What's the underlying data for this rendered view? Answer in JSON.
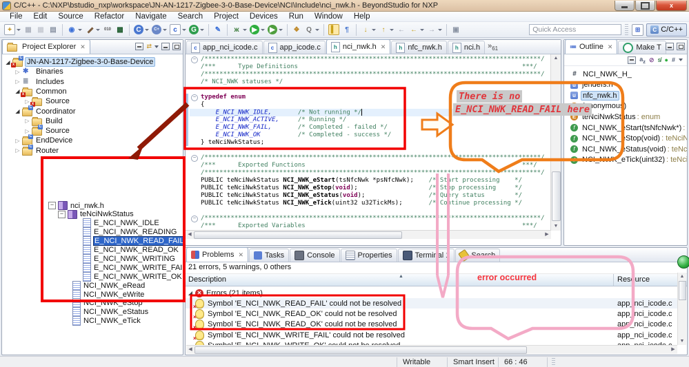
{
  "titlebar": {
    "title": "C/C++ - C:\\NXP\\bstudio_nxp\\workspace\\JN-AN-1217-Zigbee-3-0-Base-Device\\NCI\\Include\\nci_nwk.h - BeyondStudio for NXP"
  },
  "menubar": {
    "items": [
      "File",
      "Edit",
      "Source",
      "Refactor",
      "Navigate",
      "Search",
      "Project",
      "Devices",
      "Run",
      "Window",
      "Help"
    ]
  },
  "toolbar": {
    "quick_access_placeholder": "Quick Access",
    "perspective_label": "C/C++",
    "groups": [
      [
        {
          "n": "new-button",
          "g": "+",
          "cls": "box",
          "c": "#b8860b",
          "dd": 1
        },
        {
          "n": "save-button",
          "g": "▦",
          "c": "#b0b5c0"
        },
        {
          "n": "save-all-button",
          "g": "▦",
          "c": "#c8ccd4"
        },
        {
          "n": "print-button",
          "g": "▤",
          "c": "#8a93a3"
        }
      ],
      [
        {
          "n": "skip-breakpoints-button",
          "g": "◉",
          "c": "#3a6fd8",
          "dd": 1
        },
        {
          "n": "build-button",
          "g": "▬",
          "cls": "rot",
          "c": "#7a5c3e",
          "dd": 1
        },
        {
          "n": "binary-button",
          "g": "010",
          "cls": "tiny",
          "c": "#555"
        },
        {
          "n": "build-all-button",
          "g": "▩",
          "c": "#1e5c2e"
        }
      ],
      [
        {
          "n": "new-c-project-button",
          "g": "C",
          "cls": "round",
          "c": "#fff",
          "bg": "#4a78d0",
          "dd": 1
        },
        {
          "n": "new-cpp-project-button",
          "g": "C+",
          "cls": "tiny round",
          "c": "#fff",
          "bg": "#6a88c8",
          "dd": 1
        },
        {
          "n": "new-c-file-button",
          "g": "c",
          "cls": "box",
          "c": "#2f5fd0",
          "dd": 1
        },
        {
          "n": "relaunch-button",
          "g": "G",
          "cls": "round",
          "c": "#fff",
          "bg": "#2f9e4f",
          "dd": 1
        }
      ],
      [
        {
          "n": "pen-button",
          "g": "✎",
          "c": "#3a6fd8"
        }
      ],
      [
        {
          "n": "debug-button",
          "g": "ж",
          "c": "#3e7d3e",
          "dd": 1
        },
        {
          "n": "run-button",
          "g": "▶",
          "cls": "round",
          "c": "#fff",
          "bg": "#2fae3f",
          "dd": 1
        },
        {
          "n": "external-tools-button",
          "g": "▶",
          "cls": "round",
          "c": "#fff",
          "bg": "#4f9e3f",
          "dd": 1
        }
      ],
      [
        {
          "n": "open-element-button",
          "g": "❖",
          "c": "#c08a2a"
        },
        {
          "n": "search-button",
          "g": "Q",
          "c": "#777",
          "dd": 1
        }
      ],
      [
        {
          "n": "mark-occurrences-button",
          "g": "▍",
          "cls": "pressed",
          "c": "#c8a018"
        },
        {
          "n": "show-whitespace-button",
          "g": "¶",
          "c": "#4a78d0"
        }
      ],
      [
        {
          "n": "next-annotation-button",
          "g": "↓",
          "c": "#c8a018",
          "dd": 1
        },
        {
          "n": "prev-annotation-button",
          "g": "↑",
          "c": "#c8a018",
          "dd": 1
        },
        {
          "n": "last-edit-button",
          "g": "←",
          "c": "#9aa0ae"
        },
        {
          "n": "back-button",
          "g": "←",
          "c": "#c8a018",
          "dd": 1
        },
        {
          "n": "forward-button",
          "g": "→",
          "c": "#9aa0ae",
          "dd": 1
        }
      ],
      [
        {
          "n": "pin-editor-button",
          "g": "▣",
          "c": "#8a93a3"
        }
      ]
    ]
  },
  "explorer": {
    "title": "Project Explorer",
    "items": [
      {
        "label": "JN-AN-1217-Zigbee-3-0-Base-Device",
        "icon": "project",
        "level": 0,
        "exp": "open",
        "selected": true
      },
      {
        "label": "Binaries",
        "icon": "binaries",
        "level": 1,
        "exp": "closed"
      },
      {
        "label": "Includes",
        "icon": "includes",
        "level": 1,
        "exp": "closed"
      },
      {
        "label": "Common",
        "icon": "folder-err",
        "level": 1,
        "exp": "open"
      },
      {
        "label": "Source",
        "icon": "folder-err",
        "level": 2,
        "exp": "closed"
      },
      {
        "label": "Coordinator",
        "icon": "folder-c",
        "level": 1,
        "exp": "open"
      },
      {
        "label": "Build",
        "icon": "folder",
        "level": 2,
        "exp": "closed"
      },
      {
        "label": "Source",
        "icon": "folder-c",
        "level": 2,
        "exp": "closed"
      },
      {
        "label": "EndDevice",
        "icon": "folder-c",
        "level": 1,
        "exp": "closed"
      },
      {
        "label": "Router",
        "icon": "folder-c",
        "level": 1,
        "exp": "closed"
      }
    ]
  },
  "boxtree": {
    "items": [
      {
        "label": "nci_nwk.h",
        "icon": "book",
        "indent": 3,
        "pm": true
      },
      {
        "label": "teNciNwkStatus",
        "icon": "book",
        "indent": 17,
        "pm": true
      },
      {
        "label": "E_NCI_NWK_IDLE",
        "icon": "doc",
        "indent": 53
      },
      {
        "label": "E_NCI_NWK_READING",
        "icon": "doc",
        "indent": 53
      },
      {
        "label": "E_NCI_NWK_READ_FAIL",
        "icon": "doc",
        "indent": 53,
        "selected": true
      },
      {
        "label": "E_NCI_NWK_READ_OK",
        "icon": "doc",
        "indent": 53
      },
      {
        "label": "E_NCI_NWK_WRITING",
        "icon": "doc",
        "indent": 53
      },
      {
        "label": "E_NCI_NWK_WRITE_FAIL",
        "icon": "doc",
        "indent": 53
      },
      {
        "label": "E_NCI_NWK_WRITE_OK",
        "icon": "doc",
        "indent": 53
      },
      {
        "label": "NCI_NWK_eRead",
        "icon": "doc",
        "indent": 38
      },
      {
        "label": "NCI_NWK_eWrite",
        "icon": "doc",
        "indent": 38
      },
      {
        "label": "NCI_NWK_eStop",
        "icon": "doc",
        "indent": 38
      },
      {
        "label": "NCI_NWK_eStatus",
        "icon": "doc",
        "indent": 38
      },
      {
        "label": "NCI_NWK_eTick",
        "icon": "doc",
        "indent": 38
      }
    ]
  },
  "editor": {
    "tabs": [
      {
        "label": "app_nci_icode.c",
        "icon": "c"
      },
      {
        "label": "app_icode.c",
        "icon": "c"
      },
      {
        "label": "nci_nwk.h",
        "icon": "h",
        "active": true
      },
      {
        "label": "nfc_nwk.h",
        "icon": "h"
      },
      {
        "label": "nci.h",
        "icon": "h"
      }
    ],
    "overflow_count": "61",
    "code_lines": [
      {
        "fold": true,
        "segs": [
          [
            "c",
            "/******************************************************************************************/"
          ]
        ]
      },
      {
        "segs": [
          [
            "c",
            "/***      Type Definitions                                                            ***/"
          ]
        ]
      },
      {
        "segs": [
          [
            "c",
            "/******************************************************************************************/"
          ]
        ]
      },
      {
        "segs": [
          [
            "c",
            "/* NCI_NWK statuses */"
          ]
        ]
      },
      {
        "segs": []
      },
      {
        "fold": true,
        "segs": [
          [
            "k",
            "typedef"
          ],
          [
            "p",
            " "
          ],
          [
            "k",
            "enum"
          ]
        ]
      },
      {
        "segs": [
          [
            "p",
            "{"
          ]
        ]
      },
      {
        "hl": true,
        "segs": [
          [
            "e",
            "    E_NCI_NWK_IDLE,"
          ],
          [
            "p",
            "       "
          ],
          [
            "c",
            "/* Not running */"
          ],
          [
            "cur",
            ""
          ]
        ]
      },
      {
        "segs": [
          [
            "e",
            "    E_NCI_NWK_ACTIVE,"
          ],
          [
            "p",
            "     "
          ],
          [
            "c",
            "/* Running */"
          ]
        ]
      },
      {
        "segs": [
          [
            "e",
            "    E_NCI_NWK_FAIL,"
          ],
          [
            "p",
            "       "
          ],
          [
            "c",
            "/* Completed - failed */"
          ]
        ]
      },
      {
        "segs": [
          [
            "e",
            "    E_NCI_NWK_OK"
          ],
          [
            "p",
            "          "
          ],
          [
            "c",
            "/* Completed - success */"
          ]
        ]
      },
      {
        "segs": [
          [
            "p",
            "} teNciNwkStatus;"
          ]
        ]
      },
      {
        "segs": []
      },
      {
        "fold": true,
        "segs": [
          [
            "c",
            "/******************************************************************************************/"
          ]
        ]
      },
      {
        "segs": [
          [
            "c",
            "/***      Exported Functions                                                          ***/"
          ]
        ]
      },
      {
        "segs": [
          [
            "c",
            "/******************************************************************************************/"
          ]
        ]
      },
      {
        "segs": [
          [
            "p",
            "PUBLIC teNciNwkStatus "
          ],
          [
            "f",
            "NCI_NWK_eStart"
          ],
          [
            "p",
            "(tsNfcNwk *psNfcNwk);"
          ],
          [
            "p",
            "    "
          ],
          [
            "c",
            "/* Start processing    */"
          ]
        ]
      },
      {
        "segs": [
          [
            "p",
            "PUBLIC teNciNwkStatus "
          ],
          [
            "f",
            "NCI_NWK_eStop"
          ],
          [
            "p",
            "("
          ],
          [
            "k",
            "void"
          ],
          [
            "p",
            ");"
          ],
          [
            "p",
            "                   "
          ],
          [
            "c",
            "/* Stop processing     */"
          ]
        ]
      },
      {
        "segs": [
          [
            "p",
            "PUBLIC teNciNwkStatus "
          ],
          [
            "f",
            "NCI_NWK_eStatus"
          ],
          [
            "p",
            "("
          ],
          [
            "k",
            "void"
          ],
          [
            "p",
            ");"
          ],
          [
            "p",
            "                 "
          ],
          [
            "c",
            "/* Query status        */"
          ]
        ]
      },
      {
        "segs": [
          [
            "p",
            "PUBLIC teNciNwkStatus "
          ],
          [
            "f",
            "NCI_NWK_eTick"
          ],
          [
            "p",
            "(uint32 u32TickMs);"
          ],
          [
            "p",
            "       "
          ],
          [
            "c",
            "/* Continue processing */"
          ]
        ]
      },
      {
        "segs": []
      },
      {
        "fold": true,
        "segs": [
          [
            "c",
            "/******************************************************************************************/"
          ]
        ]
      },
      {
        "segs": [
          [
            "c",
            "/***      Exported Variables                                                          ***/"
          ]
        ]
      },
      {
        "segs": [
          [
            "c",
            "/******************************************************************************************/"
          ]
        ]
      }
    ]
  },
  "outline": {
    "tab_outline": "Outline",
    "tab_make": "Make T",
    "items": [
      {
        "icon": "def",
        "label": "NCI_NWK_H_"
      },
      {
        "icon": "inc",
        "label": "jendefs.h"
      },
      {
        "icon": "inc",
        "label": "nfc_nwk.h",
        "selected": true
      },
      {
        "icon": "enum",
        "label": "(anonymous)",
        "exp": "closed"
      },
      {
        "icon": "enum",
        "label": "teNciNwkStatus",
        "type": " : enum"
      },
      {
        "icon": "func",
        "label": "NCI_NWK_eStart(tsNfcNwk*)",
        "type": " : te"
      },
      {
        "icon": "func",
        "label": "NCI_NWK_eStop(void)",
        "type": " : teNciNw"
      },
      {
        "icon": "func",
        "label": "NCI_NWK_eStatus(void)",
        "type": " : teNciN"
      },
      {
        "icon": "func",
        "label": "NCI_NWK_eTick(uint32)",
        "type": " : teNciN"
      }
    ]
  },
  "problems": {
    "tabs": [
      {
        "label": "Problems",
        "icon": "pi-problems",
        "active": true
      },
      {
        "label": "Tasks",
        "icon": "pi-tasks"
      },
      {
        "label": "Console",
        "icon": "pi-console"
      },
      {
        "label": "Properties",
        "icon": "pi-properties"
      },
      {
        "label": "Terminal 1",
        "icon": "pi-terminal"
      },
      {
        "label": "Search",
        "icon": "pi-search"
      }
    ],
    "summary": "21 errors, 5 warnings, 0 others",
    "col_description": "Description",
    "col_resource": "Resource",
    "group_label": "Errors (21 items)",
    "rows": [
      {
        "description": "Symbol 'E_NCI_NWK_READ_FAIL' could not be resolved",
        "resource": "app_nci_icode.c",
        "shade": true
      },
      {
        "description": "Symbol 'E_NCI_NWK_READ_OK' could not be resolved",
        "resource": "app_nci_icode.c"
      },
      {
        "description": "Symbol 'E_NCI_NWK_READ_OK' could not be resolved",
        "resource": "app_nci_icode.c"
      },
      {
        "description": "Symbol 'E_NCI_NWK_WRITE_FAIL' could not be resolved",
        "resource": "app_nci_icode.c"
      },
      {
        "description": "Symbol 'E_NCI_NWK_WRITE_OK' could not be resolved",
        "resource": "app_nci_icode.c"
      }
    ]
  },
  "statusbar": {
    "writable": "Writable",
    "insert_mode": "Smart Insert",
    "position": "66 : 46"
  },
  "annotations": {
    "bubble_top_line1": "There is no",
    "bubble_top_line2": "E_NCI_NWK_READ_FAIL here",
    "bubble_bottom_text": "error occurred",
    "red_box_color": "#f20000",
    "orange_color": "#ef7d1a",
    "pink_color": "#f3aac6",
    "dark_red_arrow_color": "#8f1a06"
  }
}
